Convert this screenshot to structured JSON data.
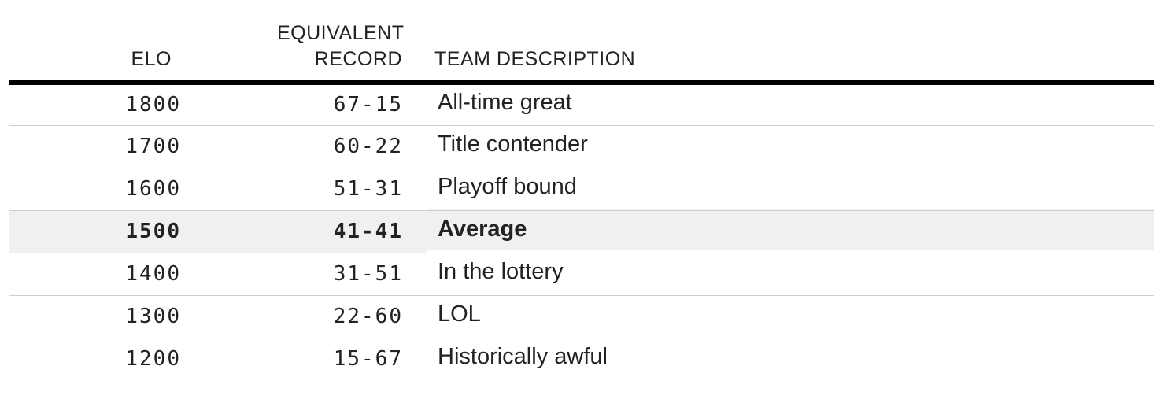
{
  "table": {
    "headers": {
      "elo": "ELO",
      "record_line1": "EQUIVALENT",
      "record_line2": "RECORD",
      "description": "TEAM DESCRIPTION"
    },
    "rows": [
      {
        "elo": "1800",
        "record": "67-15",
        "description": "All-time great",
        "highlighted": false
      },
      {
        "elo": "1700",
        "record": "60-22",
        "description": "Title contender",
        "highlighted": false
      },
      {
        "elo": "1600",
        "record": "51-31",
        "description": "Playoff bound",
        "highlighted": false
      },
      {
        "elo": "1500",
        "record": "41-41",
        "description": "Average",
        "highlighted": true
      },
      {
        "elo": "1400",
        "record": "31-51",
        "description": "In the lottery",
        "highlighted": false
      },
      {
        "elo": "1300",
        "record": "22-60",
        "description": "LOL",
        "highlighted": false
      },
      {
        "elo": "1200",
        "record": "15-67",
        "description": "Historically awful",
        "highlighted": false
      }
    ]
  },
  "colors": {
    "highlight_row": "#f0f0f0",
    "header_rule": "#000000",
    "row_divider": "#cfcfcf",
    "text": "#222222"
  }
}
